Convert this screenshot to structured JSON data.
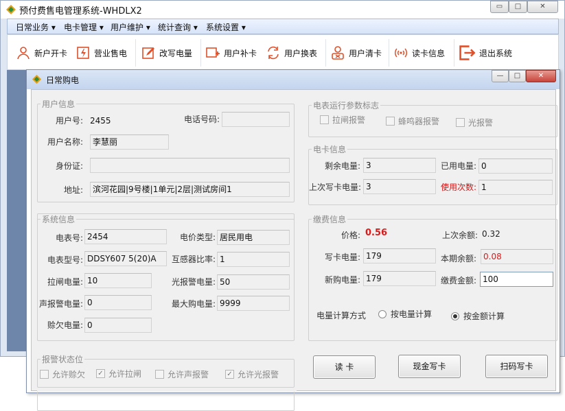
{
  "main_window": {
    "title": "预付费售电管理系统-WHDLX2",
    "controls": {
      "minimize": "▭",
      "maximize": "□",
      "close": "✕"
    }
  },
  "menu": [
    "日常业务",
    "电卡管理",
    "用户维护",
    "统计查询",
    "系统设置"
  ],
  "menu_arrow": "▾",
  "toolbar": [
    {
      "label": "新户开卡",
      "icon": "user-icon"
    },
    {
      "label": "营业售电",
      "icon": "electric-box-icon"
    },
    {
      "label": "改写电量",
      "icon": "edit-icon"
    },
    {
      "label": "用户补卡",
      "icon": "add-user-icon"
    },
    {
      "label": "用户换表",
      "icon": "exchange-icon"
    },
    {
      "label": "用户清卡",
      "icon": "clear-user-icon"
    },
    {
      "label": "读卡信息",
      "icon": "card-signal-icon"
    },
    {
      "label": "退出系统",
      "icon": "exit-icon"
    }
  ],
  "dialog": {
    "title": "日常购电",
    "controls": {
      "minimize": "—",
      "maximize": "□",
      "close": "✕"
    }
  },
  "user_info": {
    "legend": "用户信息",
    "user_no_label": "用户号:",
    "user_no": "2455",
    "phone_label": "电话号码:",
    "phone": "",
    "name_label": "用户名称:",
    "name": "李慧丽",
    "id_label": "身份证:",
    "id": "",
    "address_label": "地址:",
    "address": "滨河花园|9号楼|1单元|2层|测试房间1"
  },
  "meter_flags": {
    "legend": "电表运行参数标志",
    "items": [
      "拉闸报警",
      "蜂鸣器报警",
      "光报警"
    ]
  },
  "card_info": {
    "legend": "电卡信息",
    "remaining_label": "剩余电量:",
    "remaining": "3",
    "used_label": "已用电量:",
    "used": "0",
    "last_write_label": "上次写卡电量:",
    "last_write": "3",
    "use_count_label": "使用次数:",
    "use_count": "1"
  },
  "system_info": {
    "legend": "系统信息",
    "meter_no_label": "电表号:",
    "meter_no": "2454",
    "price_type_label": "电价类型:",
    "price_type": "居民用电",
    "meter_model_label": "电表型号:",
    "meter_model": "DDSY607 5(20)A",
    "ct_ratio_label": "互感器比率:",
    "ct_ratio": "1",
    "trip_label": "拉闸电量:",
    "trip": "10",
    "light_alarm_label": "光报警电量:",
    "light_alarm": "50",
    "sound_alarm_label": "声报警电量:",
    "sound_alarm": "0",
    "max_buy_label": "最大购电量:",
    "max_buy": "9999",
    "owed_label": "赊欠电量:",
    "owed": "0"
  },
  "payment": {
    "legend": "缴费信息",
    "price_label": "价格:",
    "price": "0.56",
    "last_balance_label": "上次余额:",
    "last_balance": "0.32",
    "write_label": "写卡电量:",
    "write": "179",
    "current_balance_label": "本期余额:",
    "current_balance": "0.08",
    "new_buy_label": "新购电量:",
    "new_buy": "179",
    "amount_label": "缴费金额:",
    "amount": "100",
    "calc_label": "电量计算方式",
    "calc_by_energy": "按电量计算",
    "calc_by_amount": "按金额计算",
    "calc_selected": "amount"
  },
  "alarm_flags": {
    "legend": "报警状态位",
    "items": [
      {
        "label": "允许赊欠",
        "checked": false
      },
      {
        "label": "允许拉闸",
        "checked": true
      },
      {
        "label": "允许声报警",
        "checked": false
      },
      {
        "label": "允许光报警",
        "checked": true
      }
    ]
  },
  "buttons": {
    "read_card": "读 卡",
    "cash_write": "现金写卡",
    "scan_write": "扫码写卡"
  },
  "colors": {
    "accent_red": "#e01818",
    "workarea": "#6f86ab"
  }
}
